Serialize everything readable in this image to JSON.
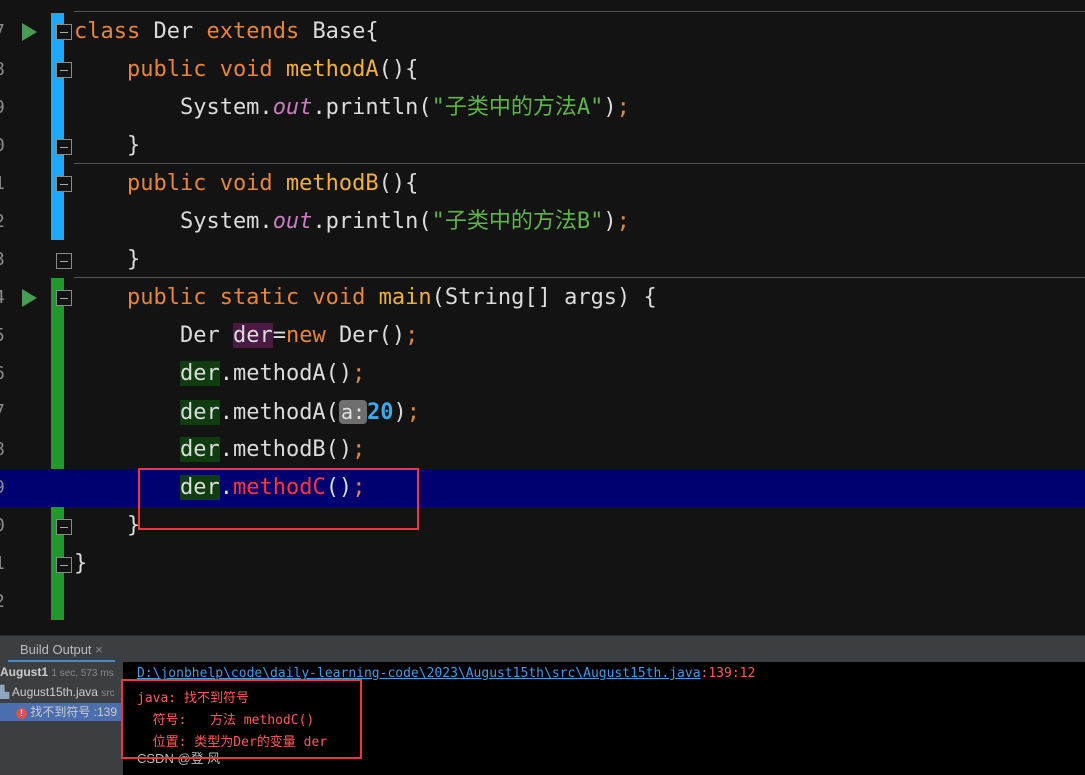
{
  "editor": {
    "line_numbers": [
      "7",
      "8",
      "9",
      "0",
      "1",
      "2",
      "3",
      "4",
      "5",
      "6",
      "7",
      "8",
      "9",
      "0",
      "1",
      "2"
    ],
    "highlighted_line": "9",
    "lines": [
      [
        [
          "class ",
          "kw"
        ],
        [
          "Der ",
          ""
        ],
        [
          "extends ",
          "kw"
        ],
        [
          "Base{",
          ""
        ]
      ],
      [
        [
          "    public void ",
          "kw"
        ],
        [
          "methodA",
          "fn"
        ],
        [
          "(){",
          ""
        ]
      ],
      [
        [
          "        System.",
          ""
        ],
        [
          "out",
          "it"
        ],
        [
          ".println(",
          ""
        ],
        [
          "\"子类中的方法A\"",
          "str"
        ],
        [
          ")",
          ""
        ],
        [
          ";",
          "punc"
        ]
      ],
      [
        [
          "    }",
          ""
        ]
      ],
      [
        [
          "    public void ",
          "kw"
        ],
        [
          "methodB",
          "fn"
        ],
        [
          "(){",
          ""
        ]
      ],
      [
        [
          "        System.",
          ""
        ],
        [
          "out",
          "it"
        ],
        [
          ".println(",
          ""
        ],
        [
          "\"子类中的方法B\"",
          "str"
        ],
        [
          ")",
          ""
        ],
        [
          ";",
          "punc"
        ]
      ],
      [
        [
          "    }",
          ""
        ]
      ],
      [
        [
          "    public static void ",
          "kw"
        ],
        [
          "main",
          "fn"
        ],
        [
          "(String[] args) {",
          ""
        ]
      ],
      [
        [
          "        Der ",
          ""
        ],
        [
          "der",
          "var"
        ],
        [
          "=",
          ""
        ],
        [
          "new ",
          "kw"
        ],
        [
          "Der()",
          ""
        ],
        [
          ";",
          "punc"
        ]
      ],
      [
        [
          "        ",
          ""
        ],
        [
          "der",
          "usage"
        ],
        [
          ".methodA()",
          ""
        ],
        [
          ";",
          "punc"
        ]
      ],
      [
        [
          "        ",
          ""
        ],
        [
          "der",
          "usage"
        ],
        [
          ".methodA(",
          ""
        ],
        [
          "a:",
          "hint"
        ],
        [
          "20",
          "num"
        ],
        [
          ")",
          ""
        ],
        [
          ";",
          "punc"
        ]
      ],
      [
        [
          "        ",
          ""
        ],
        [
          "der",
          "usage"
        ],
        [
          ".methodB()",
          ""
        ],
        [
          ";",
          "punc"
        ]
      ],
      [
        [
          "        ",
          ""
        ],
        [
          "der",
          "usage"
        ],
        [
          ".",
          ""
        ],
        [
          "methodC",
          "err"
        ],
        [
          "()",
          ""
        ],
        [
          ";",
          "punc"
        ]
      ],
      [
        [
          "    }",
          ""
        ]
      ],
      [
        [
          "}",
          ""
        ]
      ],
      [
        [
          "",
          ""
        ]
      ]
    ]
  },
  "build": {
    "tab_label": "Build Output",
    "tab_close": "×",
    "tree": {
      "root": "August1",
      "root_time": "1 sec, 573 ms",
      "file": "August15th.java",
      "file_suffix": "src",
      "error": "找不到符号 :139"
    },
    "output": {
      "path": "D:\\jonbhelp\\code\\daily-learning-code\\2023\\August15th\\src\\August15th.java",
      "position": ":139:12",
      "line1": "java: 找不到符号",
      "line2": "  符号:   方法 methodC()",
      "line3": "  位置: 类型为Der的变量 der"
    }
  },
  "watermark": "CSDN @登 风",
  "colors": {
    "accent": "#4a88c7",
    "error": "#ff3535",
    "changed": "#1ea8ff",
    "added": "#1e9a2a"
  }
}
